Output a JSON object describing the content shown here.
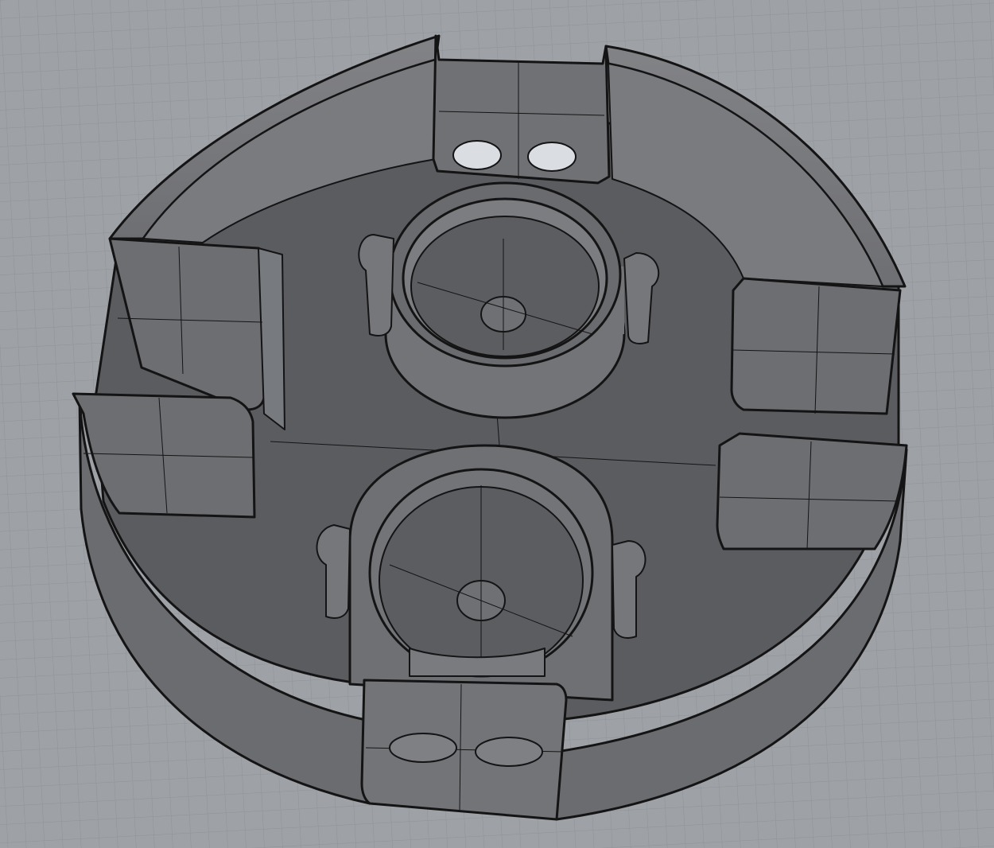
{
  "viewport": {
    "background_color": "#9ea1a5",
    "grid_color": "#8f9398",
    "model_shade_light": "#7b7c7f",
    "model_shade_mid": "#626367",
    "model_shade_dark": "#505155",
    "edge_color": "#141415",
    "hole_color": "#dadde2"
  },
  "scene": {
    "object": "circular-housing-part",
    "features": [
      "outer-wall",
      "top-socket",
      "bottom-socket",
      "left-tab-slot",
      "right-tab-slot",
      "top-tab",
      "bottom-tab"
    ]
  }
}
